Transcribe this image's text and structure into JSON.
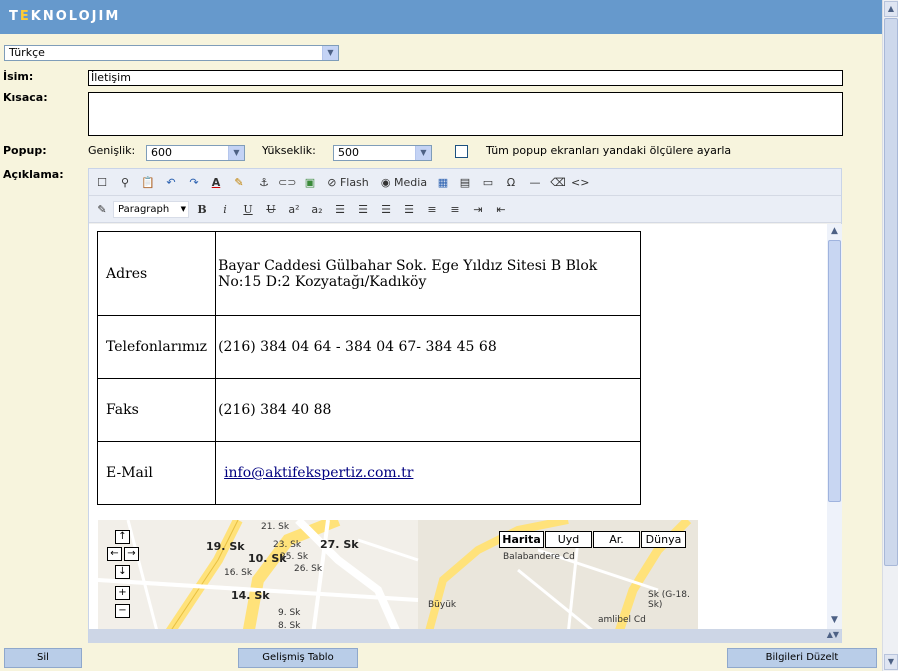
{
  "header": {
    "logo_prefix": "T",
    "logo_e": "E",
    "logo_rest": "KNOLOJIM"
  },
  "language": {
    "selected": "Türkçe"
  },
  "form": {
    "name_label": "İsim:",
    "name_value": "İletişim",
    "short_label": "Kısaca:",
    "popup_label": "Popup:",
    "width_label": "Genişlik:",
    "width_value": "600",
    "height_label": "Yükseklik:",
    "height_value": "500",
    "popup_all_label": "Tüm popup ekranları yandaki ölçülere ayarla",
    "description_label": "Açıklama:"
  },
  "editor": {
    "flash_label": "Flash",
    "media_label": "Media",
    "format_select": "Paragraph",
    "bold": "B",
    "italic": "i",
    "underline": "U",
    "strike": "U",
    "superscript": "a²",
    "subscript": "a₂",
    "special_char": "Ω",
    "source": "<>"
  },
  "contact_table": [
    {
      "key": "Adres",
      "value": "Bayar Caddesi Gülbahar Sok. Ege Yıldız Sitesi B Blok No:15 D:2 Kozyatağı/Kadıköy"
    },
    {
      "key": "Telefonlarımız",
      "value": "(216)  384 04 64 - 384 04 67- 384 45 68"
    },
    {
      "key": "Faks",
      "value": "(216) 384 40 88"
    },
    {
      "key": "E-Mail",
      "value": "info@aktifekspertiz.com.tr"
    }
  ],
  "map": {
    "types": [
      "Harita",
      "Uyd",
      "Ar.",
      "Dünya"
    ],
    "controls": {
      "up": "↑",
      "left": "←",
      "right": "→",
      "down": "↓",
      "zoom_in": "+",
      "zoom_out": "−"
    },
    "streets": [
      "19. Sk",
      "21. Sk",
      "23. Sk",
      "10. Sk",
      "25. Sk",
      "26. Sk",
      "27. Sk",
      "16. Sk",
      "14. Sk",
      "9. Sk",
      "8. Sk",
      "Büyük",
      "Balabandere Cd",
      "amlibel Cd",
      "Sk (G-18. Sk)"
    ]
  },
  "buttons": {
    "delete": "Sil",
    "advanced_table": "Gelişmiş Tablo",
    "update_info": "Bilgileri Düzelt"
  },
  "colors": {
    "header": "#6699cc",
    "background": "#f7f4dd",
    "button": "#b9cde8"
  }
}
